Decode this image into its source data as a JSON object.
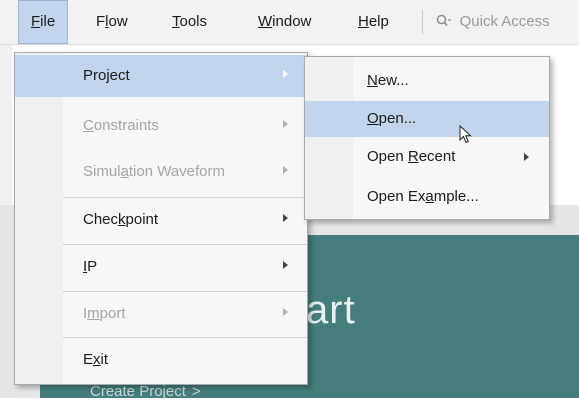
{
  "menubar": {
    "items": [
      {
        "pre": "",
        "mn": "F",
        "post": "ile"
      },
      {
        "pre": "F",
        "mn": "l",
        "post": "ow"
      },
      {
        "pre": "",
        "mn": "T",
        "post": "ools"
      },
      {
        "pre": "",
        "mn": "W",
        "post": "indow"
      },
      {
        "pre": "",
        "mn": "H",
        "post": "elp"
      }
    ],
    "quick_access_placeholder": "Quick Access"
  },
  "file_menu": {
    "items": [
      {
        "pre": "Project",
        "mn": "",
        "post": "",
        "enabled": true,
        "submenu": true,
        "highlighted": true
      },
      {
        "pre": "",
        "mn": "C",
        "post": "onstraints",
        "enabled": false,
        "submenu": true
      },
      {
        "pre": "Simul",
        "mn": "a",
        "post": "tion Waveform",
        "enabled": false,
        "submenu": true
      },
      {
        "pre": "Chec",
        "mn": "k",
        "post": "point",
        "enabled": true,
        "submenu": true
      },
      {
        "pre": "",
        "mn": "I",
        "post": "P",
        "enabled": true,
        "submenu": true
      },
      {
        "pre": "I",
        "mn": "m",
        "post": "port",
        "enabled": false,
        "submenu": true
      },
      {
        "pre": "E",
        "mn": "x",
        "post": "it",
        "enabled": true,
        "submenu": false
      }
    ]
  },
  "project_submenu": {
    "items": [
      {
        "pre": "",
        "mn": "N",
        "post": "ew...",
        "submenu": false
      },
      {
        "pre": "",
        "mn": "O",
        "post": "pen...",
        "submenu": false,
        "highlighted": true
      },
      {
        "pre": "Open ",
        "mn": "R",
        "post": "ecent",
        "submenu": true
      },
      {
        "pre": "Open Ex",
        "mn": "a",
        "post": "mple...",
        "submenu": false
      }
    ]
  },
  "background": {
    "start_text": "art",
    "create_project_text": "Create Project",
    "create_arrow": ">"
  },
  "colors": {
    "highlight": "#c2d5ec",
    "teal_panel": "#447d7b",
    "disabled_text": "#a5a5a5"
  }
}
